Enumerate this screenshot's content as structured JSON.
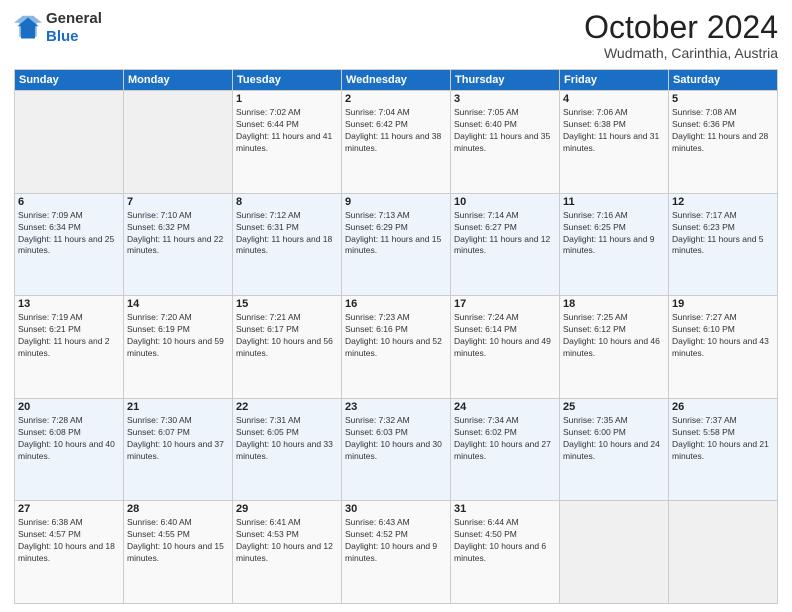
{
  "logo": {
    "general": "General",
    "blue": "Blue"
  },
  "header": {
    "month": "October 2024",
    "location": "Wudmath, Carinthia, Austria"
  },
  "days_of_week": [
    "Sunday",
    "Monday",
    "Tuesday",
    "Wednesday",
    "Thursday",
    "Friday",
    "Saturday"
  ],
  "weeks": [
    [
      {
        "day": "",
        "sunrise": "",
        "sunset": "",
        "daylight": ""
      },
      {
        "day": "",
        "sunrise": "",
        "sunset": "",
        "daylight": ""
      },
      {
        "day": "1",
        "sunrise": "Sunrise: 7:02 AM",
        "sunset": "Sunset: 6:44 PM",
        "daylight": "Daylight: 11 hours and 41 minutes."
      },
      {
        "day": "2",
        "sunrise": "Sunrise: 7:04 AM",
        "sunset": "Sunset: 6:42 PM",
        "daylight": "Daylight: 11 hours and 38 minutes."
      },
      {
        "day": "3",
        "sunrise": "Sunrise: 7:05 AM",
        "sunset": "Sunset: 6:40 PM",
        "daylight": "Daylight: 11 hours and 35 minutes."
      },
      {
        "day": "4",
        "sunrise": "Sunrise: 7:06 AM",
        "sunset": "Sunset: 6:38 PM",
        "daylight": "Daylight: 11 hours and 31 minutes."
      },
      {
        "day": "5",
        "sunrise": "Sunrise: 7:08 AM",
        "sunset": "Sunset: 6:36 PM",
        "daylight": "Daylight: 11 hours and 28 minutes."
      }
    ],
    [
      {
        "day": "6",
        "sunrise": "Sunrise: 7:09 AM",
        "sunset": "Sunset: 6:34 PM",
        "daylight": "Daylight: 11 hours and 25 minutes."
      },
      {
        "day": "7",
        "sunrise": "Sunrise: 7:10 AM",
        "sunset": "Sunset: 6:32 PM",
        "daylight": "Daylight: 11 hours and 22 minutes."
      },
      {
        "day": "8",
        "sunrise": "Sunrise: 7:12 AM",
        "sunset": "Sunset: 6:31 PM",
        "daylight": "Daylight: 11 hours and 18 minutes."
      },
      {
        "day": "9",
        "sunrise": "Sunrise: 7:13 AM",
        "sunset": "Sunset: 6:29 PM",
        "daylight": "Daylight: 11 hours and 15 minutes."
      },
      {
        "day": "10",
        "sunrise": "Sunrise: 7:14 AM",
        "sunset": "Sunset: 6:27 PM",
        "daylight": "Daylight: 11 hours and 12 minutes."
      },
      {
        "day": "11",
        "sunrise": "Sunrise: 7:16 AM",
        "sunset": "Sunset: 6:25 PM",
        "daylight": "Daylight: 11 hours and 9 minutes."
      },
      {
        "day": "12",
        "sunrise": "Sunrise: 7:17 AM",
        "sunset": "Sunset: 6:23 PM",
        "daylight": "Daylight: 11 hours and 5 minutes."
      }
    ],
    [
      {
        "day": "13",
        "sunrise": "Sunrise: 7:19 AM",
        "sunset": "Sunset: 6:21 PM",
        "daylight": "Daylight: 11 hours and 2 minutes."
      },
      {
        "day": "14",
        "sunrise": "Sunrise: 7:20 AM",
        "sunset": "Sunset: 6:19 PM",
        "daylight": "Daylight: 10 hours and 59 minutes."
      },
      {
        "day": "15",
        "sunrise": "Sunrise: 7:21 AM",
        "sunset": "Sunset: 6:17 PM",
        "daylight": "Daylight: 10 hours and 56 minutes."
      },
      {
        "day": "16",
        "sunrise": "Sunrise: 7:23 AM",
        "sunset": "Sunset: 6:16 PM",
        "daylight": "Daylight: 10 hours and 52 minutes."
      },
      {
        "day": "17",
        "sunrise": "Sunrise: 7:24 AM",
        "sunset": "Sunset: 6:14 PM",
        "daylight": "Daylight: 10 hours and 49 minutes."
      },
      {
        "day": "18",
        "sunrise": "Sunrise: 7:25 AM",
        "sunset": "Sunset: 6:12 PM",
        "daylight": "Daylight: 10 hours and 46 minutes."
      },
      {
        "day": "19",
        "sunrise": "Sunrise: 7:27 AM",
        "sunset": "Sunset: 6:10 PM",
        "daylight": "Daylight: 10 hours and 43 minutes."
      }
    ],
    [
      {
        "day": "20",
        "sunrise": "Sunrise: 7:28 AM",
        "sunset": "Sunset: 6:08 PM",
        "daylight": "Daylight: 10 hours and 40 minutes."
      },
      {
        "day": "21",
        "sunrise": "Sunrise: 7:30 AM",
        "sunset": "Sunset: 6:07 PM",
        "daylight": "Daylight: 10 hours and 37 minutes."
      },
      {
        "day": "22",
        "sunrise": "Sunrise: 7:31 AM",
        "sunset": "Sunset: 6:05 PM",
        "daylight": "Daylight: 10 hours and 33 minutes."
      },
      {
        "day": "23",
        "sunrise": "Sunrise: 7:32 AM",
        "sunset": "Sunset: 6:03 PM",
        "daylight": "Daylight: 10 hours and 30 minutes."
      },
      {
        "day": "24",
        "sunrise": "Sunrise: 7:34 AM",
        "sunset": "Sunset: 6:02 PM",
        "daylight": "Daylight: 10 hours and 27 minutes."
      },
      {
        "day": "25",
        "sunrise": "Sunrise: 7:35 AM",
        "sunset": "Sunset: 6:00 PM",
        "daylight": "Daylight: 10 hours and 24 minutes."
      },
      {
        "day": "26",
        "sunrise": "Sunrise: 7:37 AM",
        "sunset": "Sunset: 5:58 PM",
        "daylight": "Daylight: 10 hours and 21 minutes."
      }
    ],
    [
      {
        "day": "27",
        "sunrise": "Sunrise: 6:38 AM",
        "sunset": "Sunset: 4:57 PM",
        "daylight": "Daylight: 10 hours and 18 minutes."
      },
      {
        "day": "28",
        "sunrise": "Sunrise: 6:40 AM",
        "sunset": "Sunset: 4:55 PM",
        "daylight": "Daylight: 10 hours and 15 minutes."
      },
      {
        "day": "29",
        "sunrise": "Sunrise: 6:41 AM",
        "sunset": "Sunset: 4:53 PM",
        "daylight": "Daylight: 10 hours and 12 minutes."
      },
      {
        "day": "30",
        "sunrise": "Sunrise: 6:43 AM",
        "sunset": "Sunset: 4:52 PM",
        "daylight": "Daylight: 10 hours and 9 minutes."
      },
      {
        "day": "31",
        "sunrise": "Sunrise: 6:44 AM",
        "sunset": "Sunset: 4:50 PM",
        "daylight": "Daylight: 10 hours and 6 minutes."
      },
      {
        "day": "",
        "sunrise": "",
        "sunset": "",
        "daylight": ""
      },
      {
        "day": "",
        "sunrise": "",
        "sunset": "",
        "daylight": ""
      }
    ]
  ]
}
